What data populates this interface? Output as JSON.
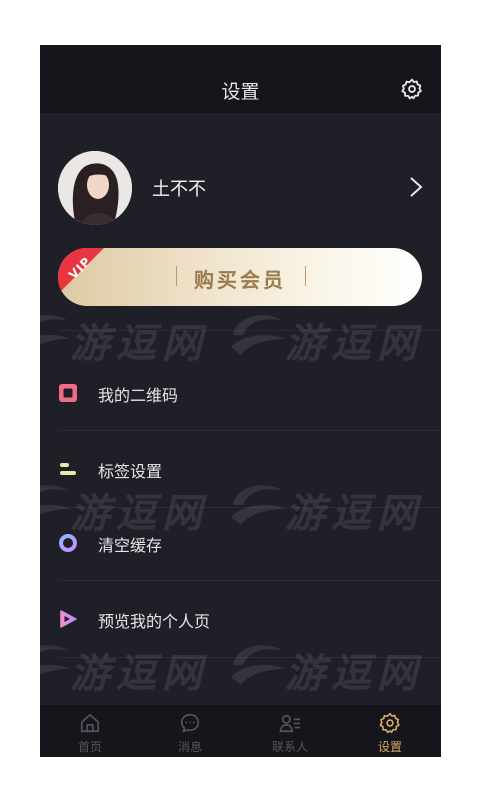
{
  "header": {
    "title": "设置"
  },
  "profile": {
    "name": "土不不"
  },
  "vip": {
    "badge": "VIP",
    "label": "购买会员"
  },
  "menu": [
    {
      "label": "我的二维码",
      "icon": "qrcode-icon"
    },
    {
      "label": "标签设置",
      "icon": "tag-settings-icon"
    },
    {
      "label": "清空缓存",
      "icon": "clear-cache-icon"
    },
    {
      "label": "预览我的个人页",
      "icon": "preview-profile-icon"
    }
  ],
  "tabs": [
    {
      "label": "首页",
      "icon": "home-icon"
    },
    {
      "label": "消息",
      "icon": "message-icon"
    },
    {
      "label": "联系人",
      "icon": "contacts-icon"
    },
    {
      "label": "设置",
      "icon": "settings-icon",
      "active": true
    }
  ],
  "watermark": {
    "text": "游逗网"
  },
  "colors": {
    "background": "#1f1f28",
    "header": "#15151b",
    "accent": "#d6a860",
    "vip_text": "#9a7b4d",
    "ribbon": "#e8353f"
  }
}
